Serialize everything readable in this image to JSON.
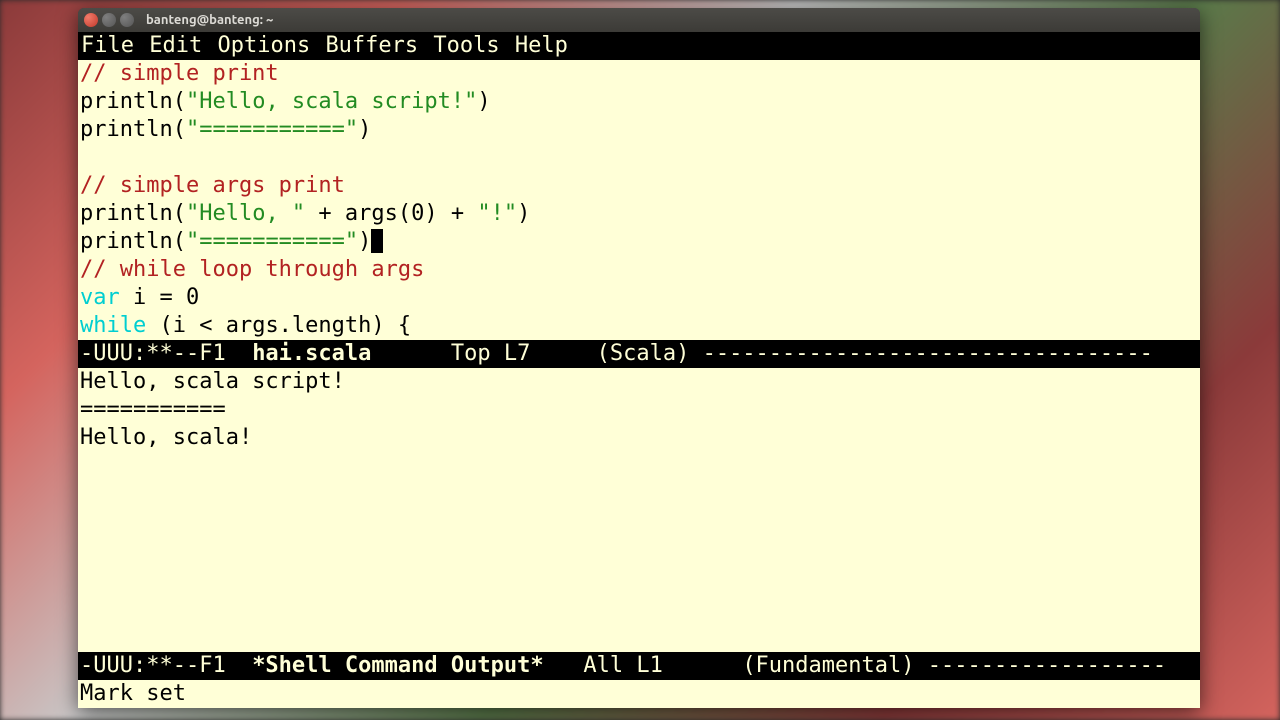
{
  "window": {
    "title": "banteng@banteng: ~"
  },
  "menubar": {
    "items": [
      "File",
      "Edit",
      "Options",
      "Buffers",
      "Tools",
      "Help"
    ]
  },
  "code": {
    "l1_comment": "// simple print",
    "l2_a": "println(",
    "l2_str": "\"Hello, scala script!\"",
    "l2_b": ")",
    "l3_a": "println(",
    "l3_str": "\"===========\"",
    "l3_b": ")",
    "l4_blank": "",
    "l5_comment": "// simple args print",
    "l6_a": "println(",
    "l6_s1": "\"Hello, \"",
    "l6_b": " + args(",
    "l6_n": "0",
    "l6_c": ") + ",
    "l6_s2": "\"!\"",
    "l6_d": ")",
    "l7_a": "println(",
    "l7_str": "\"===========\"",
    "l7_b": ")",
    "l8_comment": "// while loop through args",
    "l9_kw": "var",
    "l9_rest": " i = ",
    "l9_n": "0",
    "l10_kw": "while",
    "l10_rest": " (i < args.length) {"
  },
  "modeline1": {
    "left": "-UUU:**--F1  ",
    "buf": "hai.scala",
    "gap": "      ",
    "pos": "Top L7",
    "gap2": "     ",
    "mode": "(Scala)",
    "dash": " ----------------------------------"
  },
  "output": {
    "l1": "Hello, scala script!",
    "l2": "===========",
    "l3": "Hello, scala!"
  },
  "modeline2": {
    "left": "-UUU:**--F1  ",
    "buf": "*Shell Command Output*",
    "gap": "   ",
    "pos": "All L1",
    "gap2": "      ",
    "mode": "(Fundamental)",
    "dash": " ------------------"
  },
  "minibuffer": {
    "text": "Mark set"
  }
}
